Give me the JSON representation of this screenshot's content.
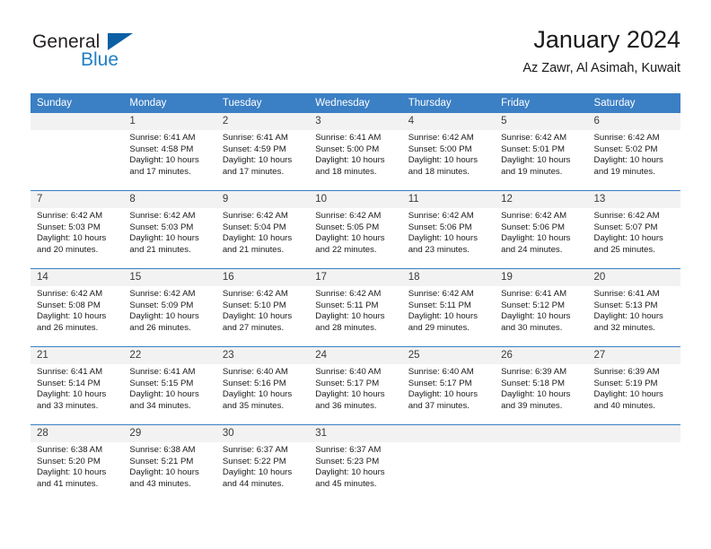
{
  "brand": {
    "name_part1": "General",
    "name_part2": "Blue",
    "triangle_color": "#0b5fa4",
    "blue_color": "#1f7fc4"
  },
  "header": {
    "title": "January 2024",
    "subtitle": "Az Zawr, Al Asimah, Kuwait",
    "header_bg": "#3b7fc4",
    "daynum_bg": "#f2f2f2"
  },
  "weekday_headers": [
    "Sunday",
    "Monday",
    "Tuesday",
    "Wednesday",
    "Thursday",
    "Friday",
    "Saturday"
  ],
  "weeks": [
    [
      {
        "day": "",
        "sunrise": "",
        "sunset": "",
        "daylight": "",
        "empty": true
      },
      {
        "day": "1",
        "sunrise": "Sunrise: 6:41 AM",
        "sunset": "Sunset: 4:58 PM",
        "daylight": "Daylight: 10 hours and 17 minutes."
      },
      {
        "day": "2",
        "sunrise": "Sunrise: 6:41 AM",
        "sunset": "Sunset: 4:59 PM",
        "daylight": "Daylight: 10 hours and 17 minutes."
      },
      {
        "day": "3",
        "sunrise": "Sunrise: 6:41 AM",
        "sunset": "Sunset: 5:00 PM",
        "daylight": "Daylight: 10 hours and 18 minutes."
      },
      {
        "day": "4",
        "sunrise": "Sunrise: 6:42 AM",
        "sunset": "Sunset: 5:00 PM",
        "daylight": "Daylight: 10 hours and 18 minutes."
      },
      {
        "day": "5",
        "sunrise": "Sunrise: 6:42 AM",
        "sunset": "Sunset: 5:01 PM",
        "daylight": "Daylight: 10 hours and 19 minutes."
      },
      {
        "day": "6",
        "sunrise": "Sunrise: 6:42 AM",
        "sunset": "Sunset: 5:02 PM",
        "daylight": "Daylight: 10 hours and 19 minutes."
      }
    ],
    [
      {
        "day": "7",
        "sunrise": "Sunrise: 6:42 AM",
        "sunset": "Sunset: 5:03 PM",
        "daylight": "Daylight: 10 hours and 20 minutes."
      },
      {
        "day": "8",
        "sunrise": "Sunrise: 6:42 AM",
        "sunset": "Sunset: 5:03 PM",
        "daylight": "Daylight: 10 hours and 21 minutes."
      },
      {
        "day": "9",
        "sunrise": "Sunrise: 6:42 AM",
        "sunset": "Sunset: 5:04 PM",
        "daylight": "Daylight: 10 hours and 21 minutes."
      },
      {
        "day": "10",
        "sunrise": "Sunrise: 6:42 AM",
        "sunset": "Sunset: 5:05 PM",
        "daylight": "Daylight: 10 hours and 22 minutes."
      },
      {
        "day": "11",
        "sunrise": "Sunrise: 6:42 AM",
        "sunset": "Sunset: 5:06 PM",
        "daylight": "Daylight: 10 hours and 23 minutes."
      },
      {
        "day": "12",
        "sunrise": "Sunrise: 6:42 AM",
        "sunset": "Sunset: 5:06 PM",
        "daylight": "Daylight: 10 hours and 24 minutes."
      },
      {
        "day": "13",
        "sunrise": "Sunrise: 6:42 AM",
        "sunset": "Sunset: 5:07 PM",
        "daylight": "Daylight: 10 hours and 25 minutes."
      }
    ],
    [
      {
        "day": "14",
        "sunrise": "Sunrise: 6:42 AM",
        "sunset": "Sunset: 5:08 PM",
        "daylight": "Daylight: 10 hours and 26 minutes."
      },
      {
        "day": "15",
        "sunrise": "Sunrise: 6:42 AM",
        "sunset": "Sunset: 5:09 PM",
        "daylight": "Daylight: 10 hours and 26 minutes."
      },
      {
        "day": "16",
        "sunrise": "Sunrise: 6:42 AM",
        "sunset": "Sunset: 5:10 PM",
        "daylight": "Daylight: 10 hours and 27 minutes."
      },
      {
        "day": "17",
        "sunrise": "Sunrise: 6:42 AM",
        "sunset": "Sunset: 5:11 PM",
        "daylight": "Daylight: 10 hours and 28 minutes."
      },
      {
        "day": "18",
        "sunrise": "Sunrise: 6:42 AM",
        "sunset": "Sunset: 5:11 PM",
        "daylight": "Daylight: 10 hours and 29 minutes."
      },
      {
        "day": "19",
        "sunrise": "Sunrise: 6:41 AM",
        "sunset": "Sunset: 5:12 PM",
        "daylight": "Daylight: 10 hours and 30 minutes."
      },
      {
        "day": "20",
        "sunrise": "Sunrise: 6:41 AM",
        "sunset": "Sunset: 5:13 PM",
        "daylight": "Daylight: 10 hours and 32 minutes."
      }
    ],
    [
      {
        "day": "21",
        "sunrise": "Sunrise: 6:41 AM",
        "sunset": "Sunset: 5:14 PM",
        "daylight": "Daylight: 10 hours and 33 minutes."
      },
      {
        "day": "22",
        "sunrise": "Sunrise: 6:41 AM",
        "sunset": "Sunset: 5:15 PM",
        "daylight": "Daylight: 10 hours and 34 minutes."
      },
      {
        "day": "23",
        "sunrise": "Sunrise: 6:40 AM",
        "sunset": "Sunset: 5:16 PM",
        "daylight": "Daylight: 10 hours and 35 minutes."
      },
      {
        "day": "24",
        "sunrise": "Sunrise: 6:40 AM",
        "sunset": "Sunset: 5:17 PM",
        "daylight": "Daylight: 10 hours and 36 minutes."
      },
      {
        "day": "25",
        "sunrise": "Sunrise: 6:40 AM",
        "sunset": "Sunset: 5:17 PM",
        "daylight": "Daylight: 10 hours and 37 minutes."
      },
      {
        "day": "26",
        "sunrise": "Sunrise: 6:39 AM",
        "sunset": "Sunset: 5:18 PM",
        "daylight": "Daylight: 10 hours and 39 minutes."
      },
      {
        "day": "27",
        "sunrise": "Sunrise: 6:39 AM",
        "sunset": "Sunset: 5:19 PM",
        "daylight": "Daylight: 10 hours and 40 minutes."
      }
    ],
    [
      {
        "day": "28",
        "sunrise": "Sunrise: 6:38 AM",
        "sunset": "Sunset: 5:20 PM",
        "daylight": "Daylight: 10 hours and 41 minutes."
      },
      {
        "day": "29",
        "sunrise": "Sunrise: 6:38 AM",
        "sunset": "Sunset: 5:21 PM",
        "daylight": "Daylight: 10 hours and 43 minutes."
      },
      {
        "day": "30",
        "sunrise": "Sunrise: 6:37 AM",
        "sunset": "Sunset: 5:22 PM",
        "daylight": "Daylight: 10 hours and 44 minutes."
      },
      {
        "day": "31",
        "sunrise": "Sunrise: 6:37 AM",
        "sunset": "Sunset: 5:23 PM",
        "daylight": "Daylight: 10 hours and 45 minutes."
      },
      {
        "day": "",
        "sunrise": "",
        "sunset": "",
        "daylight": "",
        "empty": true
      },
      {
        "day": "",
        "sunrise": "",
        "sunset": "",
        "daylight": "",
        "empty": true
      },
      {
        "day": "",
        "sunrise": "",
        "sunset": "",
        "daylight": "",
        "empty": true
      }
    ]
  ]
}
